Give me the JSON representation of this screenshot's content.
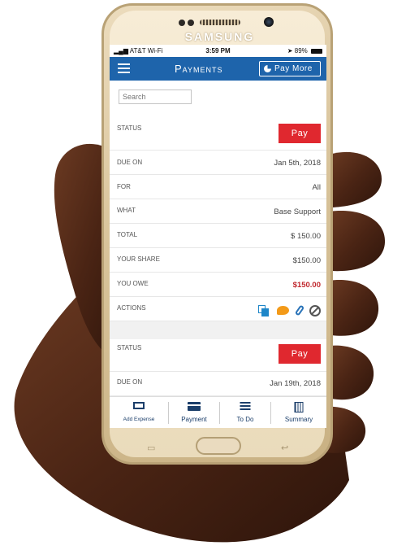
{
  "device": {
    "brand": "SAMSUNG"
  },
  "status_bar": {
    "carrier": "AT&T Wi-Fi",
    "time": "3:59 PM",
    "battery": "89%"
  },
  "header": {
    "title": "Payments",
    "pay_more_label": "Pay More"
  },
  "search": {
    "placeholder": "Search"
  },
  "payments": [
    {
      "status_label": "STATUS",
      "pay_label": "Pay",
      "due_label": "DUE ON",
      "due_value": "Jan 5th, 2018",
      "for_label": "FOR",
      "for_value": "All",
      "what_label": "WHAT",
      "what_value": "Base Support",
      "total_label": "TOTAL",
      "total_value": "$ 150.00",
      "share_label": "YOUR SHARE",
      "share_value": "$150.00",
      "owe_label": "YOU OWE",
      "owe_value": "$150.00",
      "actions_label": "ACTIONS",
      "action_icons": [
        "copy-icon",
        "chat-icon",
        "paperclip-icon",
        "cancel-icon"
      ]
    },
    {
      "status_label": "STATUS",
      "pay_label": "Pay",
      "due_label": "DUE ON",
      "due_value": "Jan 19th, 2018"
    }
  ],
  "bottom_nav": [
    {
      "label": "Add Expense",
      "icon": "money-icon"
    },
    {
      "label": "Payment",
      "icon": "card-icon"
    },
    {
      "label": "To Do",
      "icon": "list-icon"
    },
    {
      "label": "Summary",
      "icon": "calculator-icon"
    }
  ],
  "colors": {
    "header": "#1e64ab",
    "pay_button": "#e0282f",
    "owe_text": "#c0272d",
    "nav_text": "#1b3e6a"
  }
}
